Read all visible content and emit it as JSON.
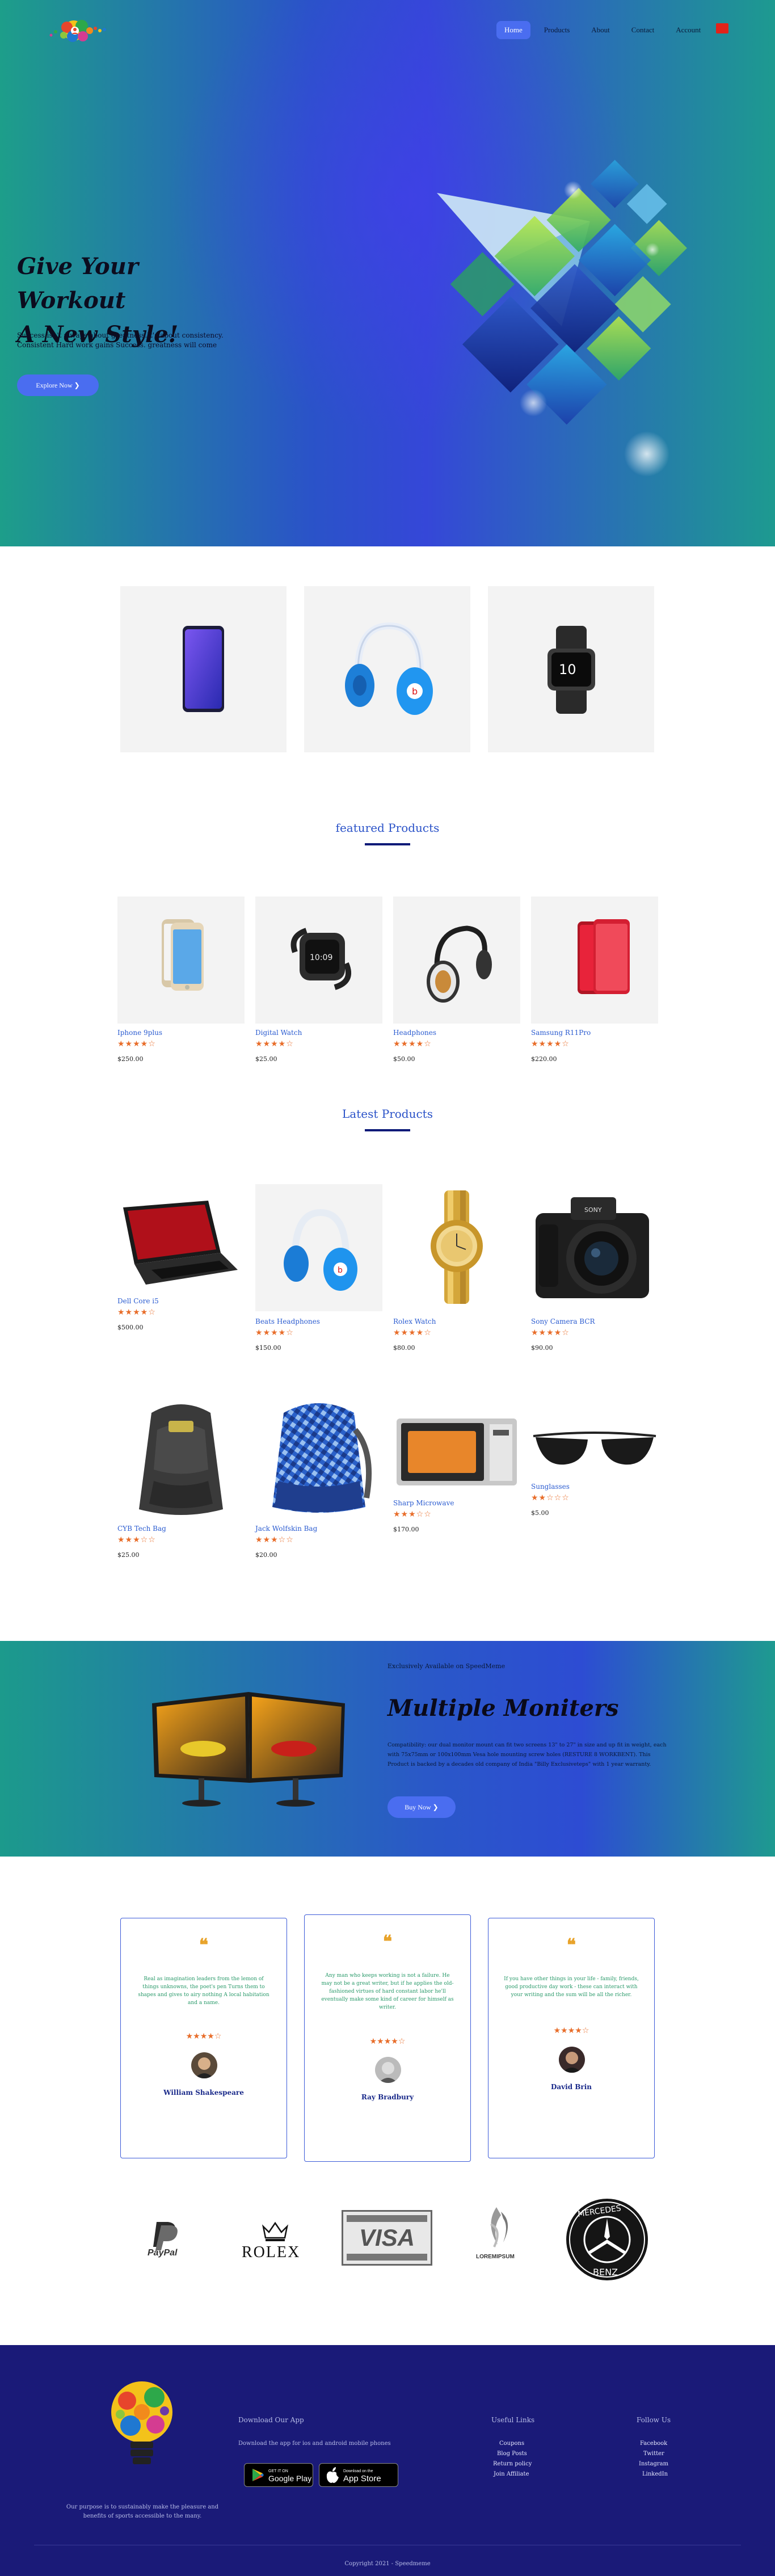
{
  "nav": {
    "items": [
      "Home",
      "Products",
      "About",
      "Contact",
      "Account"
    ],
    "active": "Home"
  },
  "hero": {
    "title_line1": "Give Your Workout",
    "title_line2": "A New Style!",
    "subtitle_line1": "Success isn't always about greatness.It's about consistency.",
    "subtitle_line2": "Consistent Hard work gains Success. greatness will come",
    "button": "Explore Now ❯"
  },
  "featured": {
    "title": "featured Products",
    "products": [
      {
        "name": "Iphone 9plus",
        "stars": "★★★★☆",
        "rating": 4,
        "price": "$250.00"
      },
      {
        "name": "Digital Watch",
        "stars": "★★★★☆",
        "rating": 3.5,
        "price": "$25.00"
      },
      {
        "name": "Headphones",
        "stars": "★★★★☆",
        "rating": 3.5,
        "price": "$50.00"
      },
      {
        "name": "Samsung R11Pro",
        "stars": "★★★★☆",
        "rating": 4,
        "price": "$220.00"
      }
    ]
  },
  "latest": {
    "title": "Latest Products",
    "products": [
      {
        "name": "Dell Core i5",
        "stars": "★★★★☆",
        "rating": 4,
        "price": "$500.00"
      },
      {
        "name": "Beats Headphones",
        "stars": "★★★★☆",
        "rating": 4,
        "price": "$150.00"
      },
      {
        "name": "Rolex Watch",
        "stars": "★★★★☆",
        "rating": 3.5,
        "price": "$80.00"
      },
      {
        "name": "Sony Camera BCR",
        "stars": "★★★★☆",
        "rating": 3.5,
        "price": "$90.00"
      },
      {
        "name": "CYB Tech Bag",
        "stars": "★★★☆☆",
        "rating": 3,
        "price": "$25.00"
      },
      {
        "name": "Jack Wolfskin Bag",
        "stars": "★★★☆☆",
        "rating": 3,
        "price": "$20.00"
      },
      {
        "name": "Sharp Microwave",
        "stars": "★★★☆☆",
        "rating": 2.5,
        "price": "$170.00"
      },
      {
        "name": "Sunglasses",
        "stars": "★★☆☆☆",
        "rating": 2,
        "price": "$5.00"
      }
    ]
  },
  "banner": {
    "tag": "Exclusively Available on SpeedMeme",
    "title": "Multiple Moniters",
    "body_line1": "Compatibility: our dual monitor mount can fit two screens 13\" to 27\" in size and up fit in weight, each",
    "body_line2": "with 75x75mm or 100x100mm Vesa hole mounting screw holes (RESTURE 8 WORKBENT). This",
    "body_line3": "Product is backed by a decades old company of India \"Billy Exclusiveteps\" with 1 year warranty.",
    "button": "Buy Now ❯"
  },
  "testimonials": [
    {
      "quote": "Real as imagination leaders from the lemon of things unknowns, the poet's pen Turns them to shapes and gives to airy nothing A local habitation and a name.",
      "stars": "★★★★☆",
      "rating": 4,
      "name": "William Shakespeare"
    },
    {
      "quote": "Any man who keeps working is not a failure. He may not be a great writer, but if he applies the old-fashioned virtues of hard constant labor he'll eventually make some kind of career for himself as writer.",
      "stars": "★★★★☆",
      "rating": 4,
      "name": "Ray Bradbury"
    },
    {
      "quote": "If you have other things in your life - family, friends, good productive day work - these can interact with your writing and the sum will be all the richer.",
      "stars": "★★★★☆",
      "rating": 4,
      "name": "David Brin"
    }
  ],
  "brands": [
    "PayPal",
    "ROLEX",
    "VISA",
    "LOREMIPSUM",
    "MERCEDES BENZ"
  ],
  "footer": {
    "mission": "Our purpose is to sustainably make the pleasure and benefits of sports accessible to the many.",
    "app_title": "Download Our App",
    "app_sub": "Download the app for ios and android mobile phones",
    "google_small": "GET IT ON",
    "google_big": "Google Play",
    "apple_small": "Download on the",
    "apple_big": "App Store",
    "links_title": "Useful Links",
    "links": [
      "Coupons",
      "Blog Posts",
      "Return policy",
      "Join Affiliate"
    ],
    "follow_title": "Follow Us",
    "follow": [
      "Facebook",
      "Twitter",
      "Instagram",
      "LinkedIn"
    ],
    "copyright": "Copyright 2021 - Speedmeme"
  },
  "colors": {
    "accent": "#4a6df0",
    "footer": "#1a1a78",
    "star": "#e86d2a",
    "title": "#2a52c8"
  }
}
